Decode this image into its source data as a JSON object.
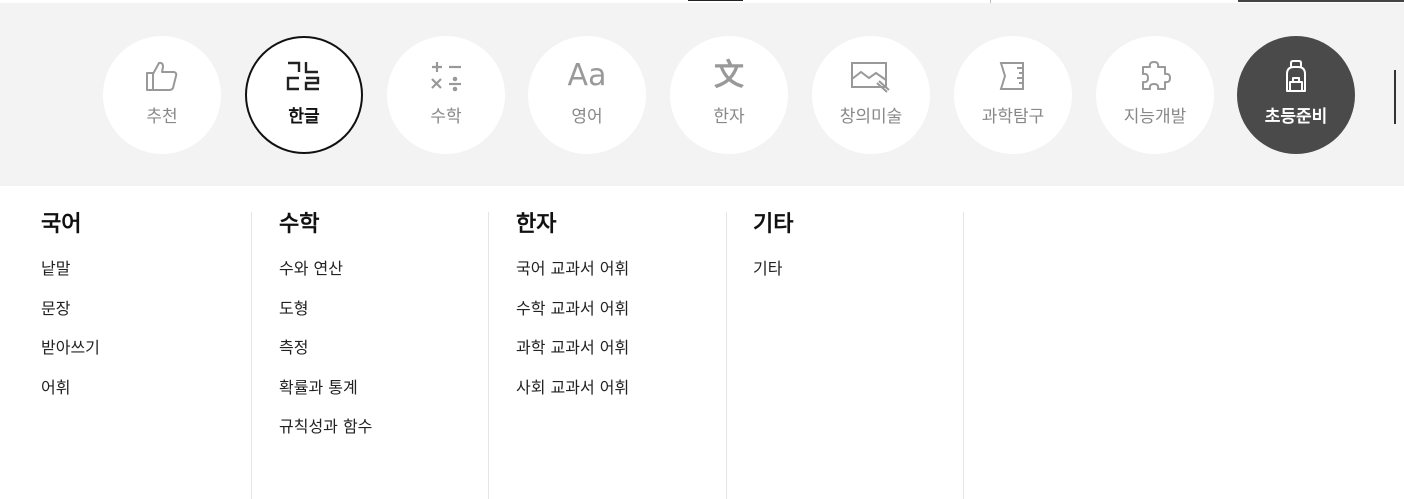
{
  "categories": [
    {
      "label": "추천",
      "icon": "thumbs-up-icon",
      "state": "normal"
    },
    {
      "label": "한글",
      "icon": "hangul-icon",
      "state": "active"
    },
    {
      "label": "수학",
      "icon": "math-operators-icon",
      "state": "normal"
    },
    {
      "label": "영어",
      "icon": "english-aa-icon",
      "state": "normal"
    },
    {
      "label": "한자",
      "icon": "chinese-character-icon",
      "state": "normal"
    },
    {
      "label": "창의미술",
      "icon": "art-picture-icon",
      "state": "normal"
    },
    {
      "label": "과학탐구",
      "icon": "science-ruler-icon",
      "state": "normal"
    },
    {
      "label": "지능개발",
      "icon": "puzzle-icon",
      "state": "normal"
    },
    {
      "label": "초등준비",
      "icon": "backpack-icon",
      "state": "dark"
    }
  ],
  "hangul_glyph": "ㄱㄴ",
  "hangul_glyph2": "ㄷㄹ",
  "english_glyph": "Aa",
  "chinese_glyph": "文",
  "menu": {
    "columns": [
      {
        "title": "국어",
        "items": [
          "낱말",
          "문장",
          "받아쓰기",
          "어휘"
        ]
      },
      {
        "title": "수학",
        "items": [
          "수와 연산",
          "도형",
          "측정",
          "확률과 통계",
          "규칙성과 함수"
        ]
      },
      {
        "title": "한자",
        "items": [
          "국어 교과서 어휘",
          "수학 교과서 어휘",
          "과학 교과서 어휘",
          "사회 교과서 어휘"
        ]
      },
      {
        "title": "기타",
        "items": [
          "기타"
        ]
      }
    ]
  },
  "colors": {
    "bar_bg": "#f3f3f3",
    "dark_circle": "#4a4a4a",
    "icon_gray": "#999999"
  }
}
